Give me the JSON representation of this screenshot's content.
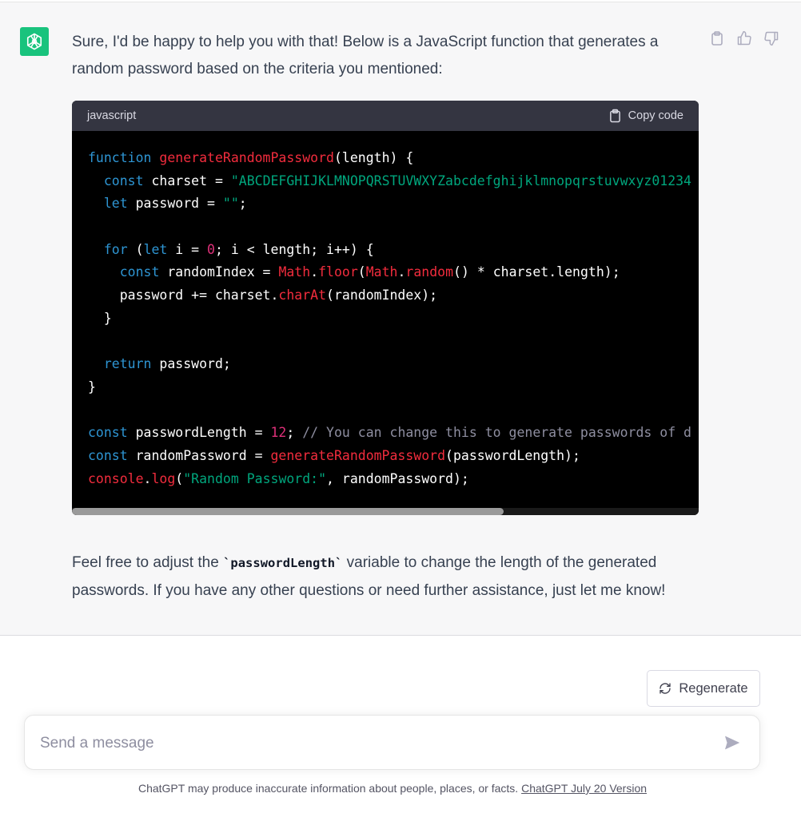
{
  "message": {
    "intro": "Sure, I'd be happy to help you with that! Below is a JavaScript function that generates a random password based on the criteria you mentioned:",
    "outro_prefix": "Feel free to adjust the ",
    "outro_code": "`passwordLength`",
    "outro_suffix": " variable to change the length of the generated passwords. If you have any other questions or need further assistance, just let me know!"
  },
  "actions": {
    "icons": [
      "clipboard-icon",
      "thumbs-up-icon",
      "thumbs-down-icon"
    ]
  },
  "code": {
    "language": "javascript",
    "copy_label": "Copy code",
    "lines": [
      [
        [
          "kw",
          "function"
        ],
        [
          "t",
          " "
        ],
        [
          "fn",
          "generateRandomPassword"
        ],
        [
          "t",
          "(length) {"
        ]
      ],
      [
        [
          "t",
          "  "
        ],
        [
          "kw",
          "const"
        ],
        [
          "t",
          " charset = "
        ],
        [
          "str",
          "\"ABCDEFGHIJKLMNOPQRSTUVWXYZabcdefghijklmnopqrstuvwxyz01234"
        ]
      ],
      [
        [
          "t",
          "  "
        ],
        [
          "kw",
          "let"
        ],
        [
          "t",
          " password = "
        ],
        [
          "str",
          "\"\""
        ],
        [
          "t",
          ";"
        ]
      ],
      [
        [
          "t",
          ""
        ]
      ],
      [
        [
          "t",
          "  "
        ],
        [
          "kw",
          "for"
        ],
        [
          "t",
          " ("
        ],
        [
          "kw",
          "let"
        ],
        [
          "t",
          " i = "
        ],
        [
          "num",
          "0"
        ],
        [
          "t",
          "; i < length; i++) {"
        ]
      ],
      [
        [
          "t",
          "    "
        ],
        [
          "kw",
          "const"
        ],
        [
          "t",
          " randomIndex = "
        ],
        [
          "fn",
          "Math"
        ],
        [
          "t",
          "."
        ],
        [
          "fn",
          "floor"
        ],
        [
          "t",
          "("
        ],
        [
          "fn",
          "Math"
        ],
        [
          "t",
          "."
        ],
        [
          "fn",
          "random"
        ],
        [
          "t",
          "() * charset.length);"
        ]
      ],
      [
        [
          "t",
          "    password += charset."
        ],
        [
          "fn",
          "charAt"
        ],
        [
          "t",
          "(randomIndex);"
        ]
      ],
      [
        [
          "t",
          "  }"
        ]
      ],
      [
        [
          "t",
          ""
        ]
      ],
      [
        [
          "t",
          "  "
        ],
        [
          "kw",
          "return"
        ],
        [
          "t",
          " password;"
        ]
      ],
      [
        [
          "t",
          "}"
        ]
      ],
      [
        [
          "t",
          ""
        ]
      ],
      [
        [
          "kw",
          "const"
        ],
        [
          "t",
          " passwordLength = "
        ],
        [
          "num",
          "12"
        ],
        [
          "t",
          "; "
        ],
        [
          "cm",
          "// You can change this to generate passwords of d"
        ]
      ],
      [
        [
          "kw",
          "const"
        ],
        [
          "t",
          " randomPassword = "
        ],
        [
          "fn",
          "generateRandomPassword"
        ],
        [
          "t",
          "(passwordLength);"
        ]
      ],
      [
        [
          "fn",
          "console"
        ],
        [
          "t",
          "."
        ],
        [
          "fn",
          "log"
        ],
        [
          "t",
          "("
        ],
        [
          "str",
          "\"Random Password:\""
        ],
        [
          "t",
          ", randomPassword);"
        ]
      ]
    ],
    "colors": {
      "kw": "#2e95d3",
      "fn": "#f22c3d",
      "str": "#00a67d",
      "num": "#df3079",
      "cm": "#8e8ea0"
    }
  },
  "regenerate_label": "Regenerate",
  "composer": {
    "placeholder": "Send a message"
  },
  "footer": {
    "text": "ChatGPT may produce inaccurate information about people, places, or facts. ",
    "link": "ChatGPT July 20 Version"
  },
  "colors": {
    "accent": "#19c37d",
    "background": "#f7f7f8"
  }
}
